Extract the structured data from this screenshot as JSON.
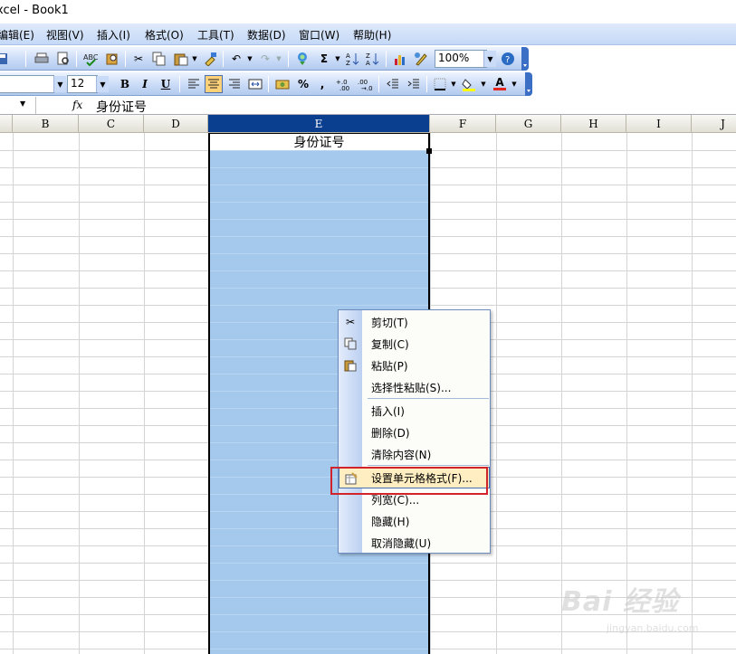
{
  "window": {
    "title": "xcel - Book1"
  },
  "menubar": {
    "items": [
      "编辑(E)",
      "视图(V)",
      "插入(I)",
      "格式(O)",
      "工具(T)",
      "数据(D)",
      "窗口(W)",
      "帮助(H)"
    ]
  },
  "toolbar_standard": {
    "zoom": "100%"
  },
  "toolbar_format": {
    "font_size": "12",
    "bold": "B",
    "italic": "I",
    "underline": "U",
    "percent": "%",
    "comma": ",",
    "font_color_letter": "A"
  },
  "formula_bar": {
    "fx": "fx",
    "content": "身份证号"
  },
  "sheet": {
    "columns": [
      "B",
      "C",
      "D",
      "E",
      "F",
      "G",
      "H",
      "I",
      "J"
    ],
    "selected_column": "E",
    "active_cell_value": "身份证号"
  },
  "context_menu": {
    "items": [
      {
        "label": "剪切(T)",
        "icon": "scissors-icon"
      },
      {
        "label": "复制(C)",
        "icon": "copy-icon"
      },
      {
        "label": "粘贴(P)",
        "icon": "paste-icon"
      },
      {
        "label": "选择性粘贴(S)...",
        "icon": ""
      },
      {
        "label": "插入(I)",
        "icon": ""
      },
      {
        "label": "删除(D)",
        "icon": ""
      },
      {
        "label": "清除内容(N)",
        "icon": ""
      },
      {
        "label": "设置单元格格式(F)...",
        "icon": "format-cells-icon",
        "highlighted": true
      },
      {
        "label": "列宽(C)...",
        "icon": ""
      },
      {
        "label": "隐藏(H)",
        "icon": ""
      },
      {
        "label": "取消隐藏(U)",
        "icon": ""
      }
    ]
  },
  "colors": {
    "selection": "#a5c9ed",
    "menu_hover": "#ffeec2",
    "annotation_red": "#d2232a",
    "header_selected": "#0a3e8f"
  },
  "watermark": {
    "logo_text": "Bai 经验",
    "url_text": "jingyan.baidu.com"
  }
}
